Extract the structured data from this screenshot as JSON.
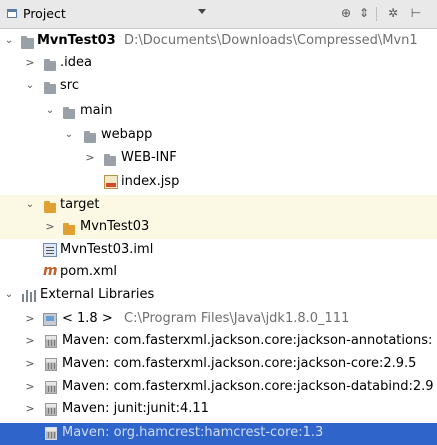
{
  "header": {
    "title": "Project",
    "tools": [
      "target-icon",
      "split-icon",
      "gear-icon",
      "hide-icon"
    ]
  },
  "tree": [
    {
      "name": "MvnTest03",
      "path": "D:\\Documents\\Downloads\\Compressed\\Mvn1"
    },
    {
      "name": ".idea"
    },
    {
      "name": "src"
    },
    {
      "name": "main"
    },
    {
      "name": "webapp"
    },
    {
      "name": "WEB-INF"
    },
    {
      "name": "index.jsp"
    },
    {
      "name": "target"
    },
    {
      "name": "MvnTest03"
    },
    {
      "name": "MvnTest03.iml"
    },
    {
      "name": "pom.xml"
    },
    {
      "name": "External Libraries"
    },
    {
      "name": "< 1.8 >",
      "path": "C:\\Program Files\\Java\\jdk1.8.0_111"
    },
    {
      "name": "Maven: com.fasterxml.jackson.core:jackson-annotations:"
    },
    {
      "name": "Maven: com.fasterxml.jackson.core:jackson-core:2.9.5"
    },
    {
      "name": "Maven: com.fasterxml.jackson.core:jackson-databind:2.9"
    },
    {
      "name": "Maven: junit:junit:4.11"
    },
    {
      "name": "Maven: org.hamcrest:hamcrest-core:1.3"
    }
  ],
  "colors": {
    "selection": "#2f65ca",
    "excluded_bg": "#fbf9e4",
    "folder_excluded": "#e1a033"
  }
}
